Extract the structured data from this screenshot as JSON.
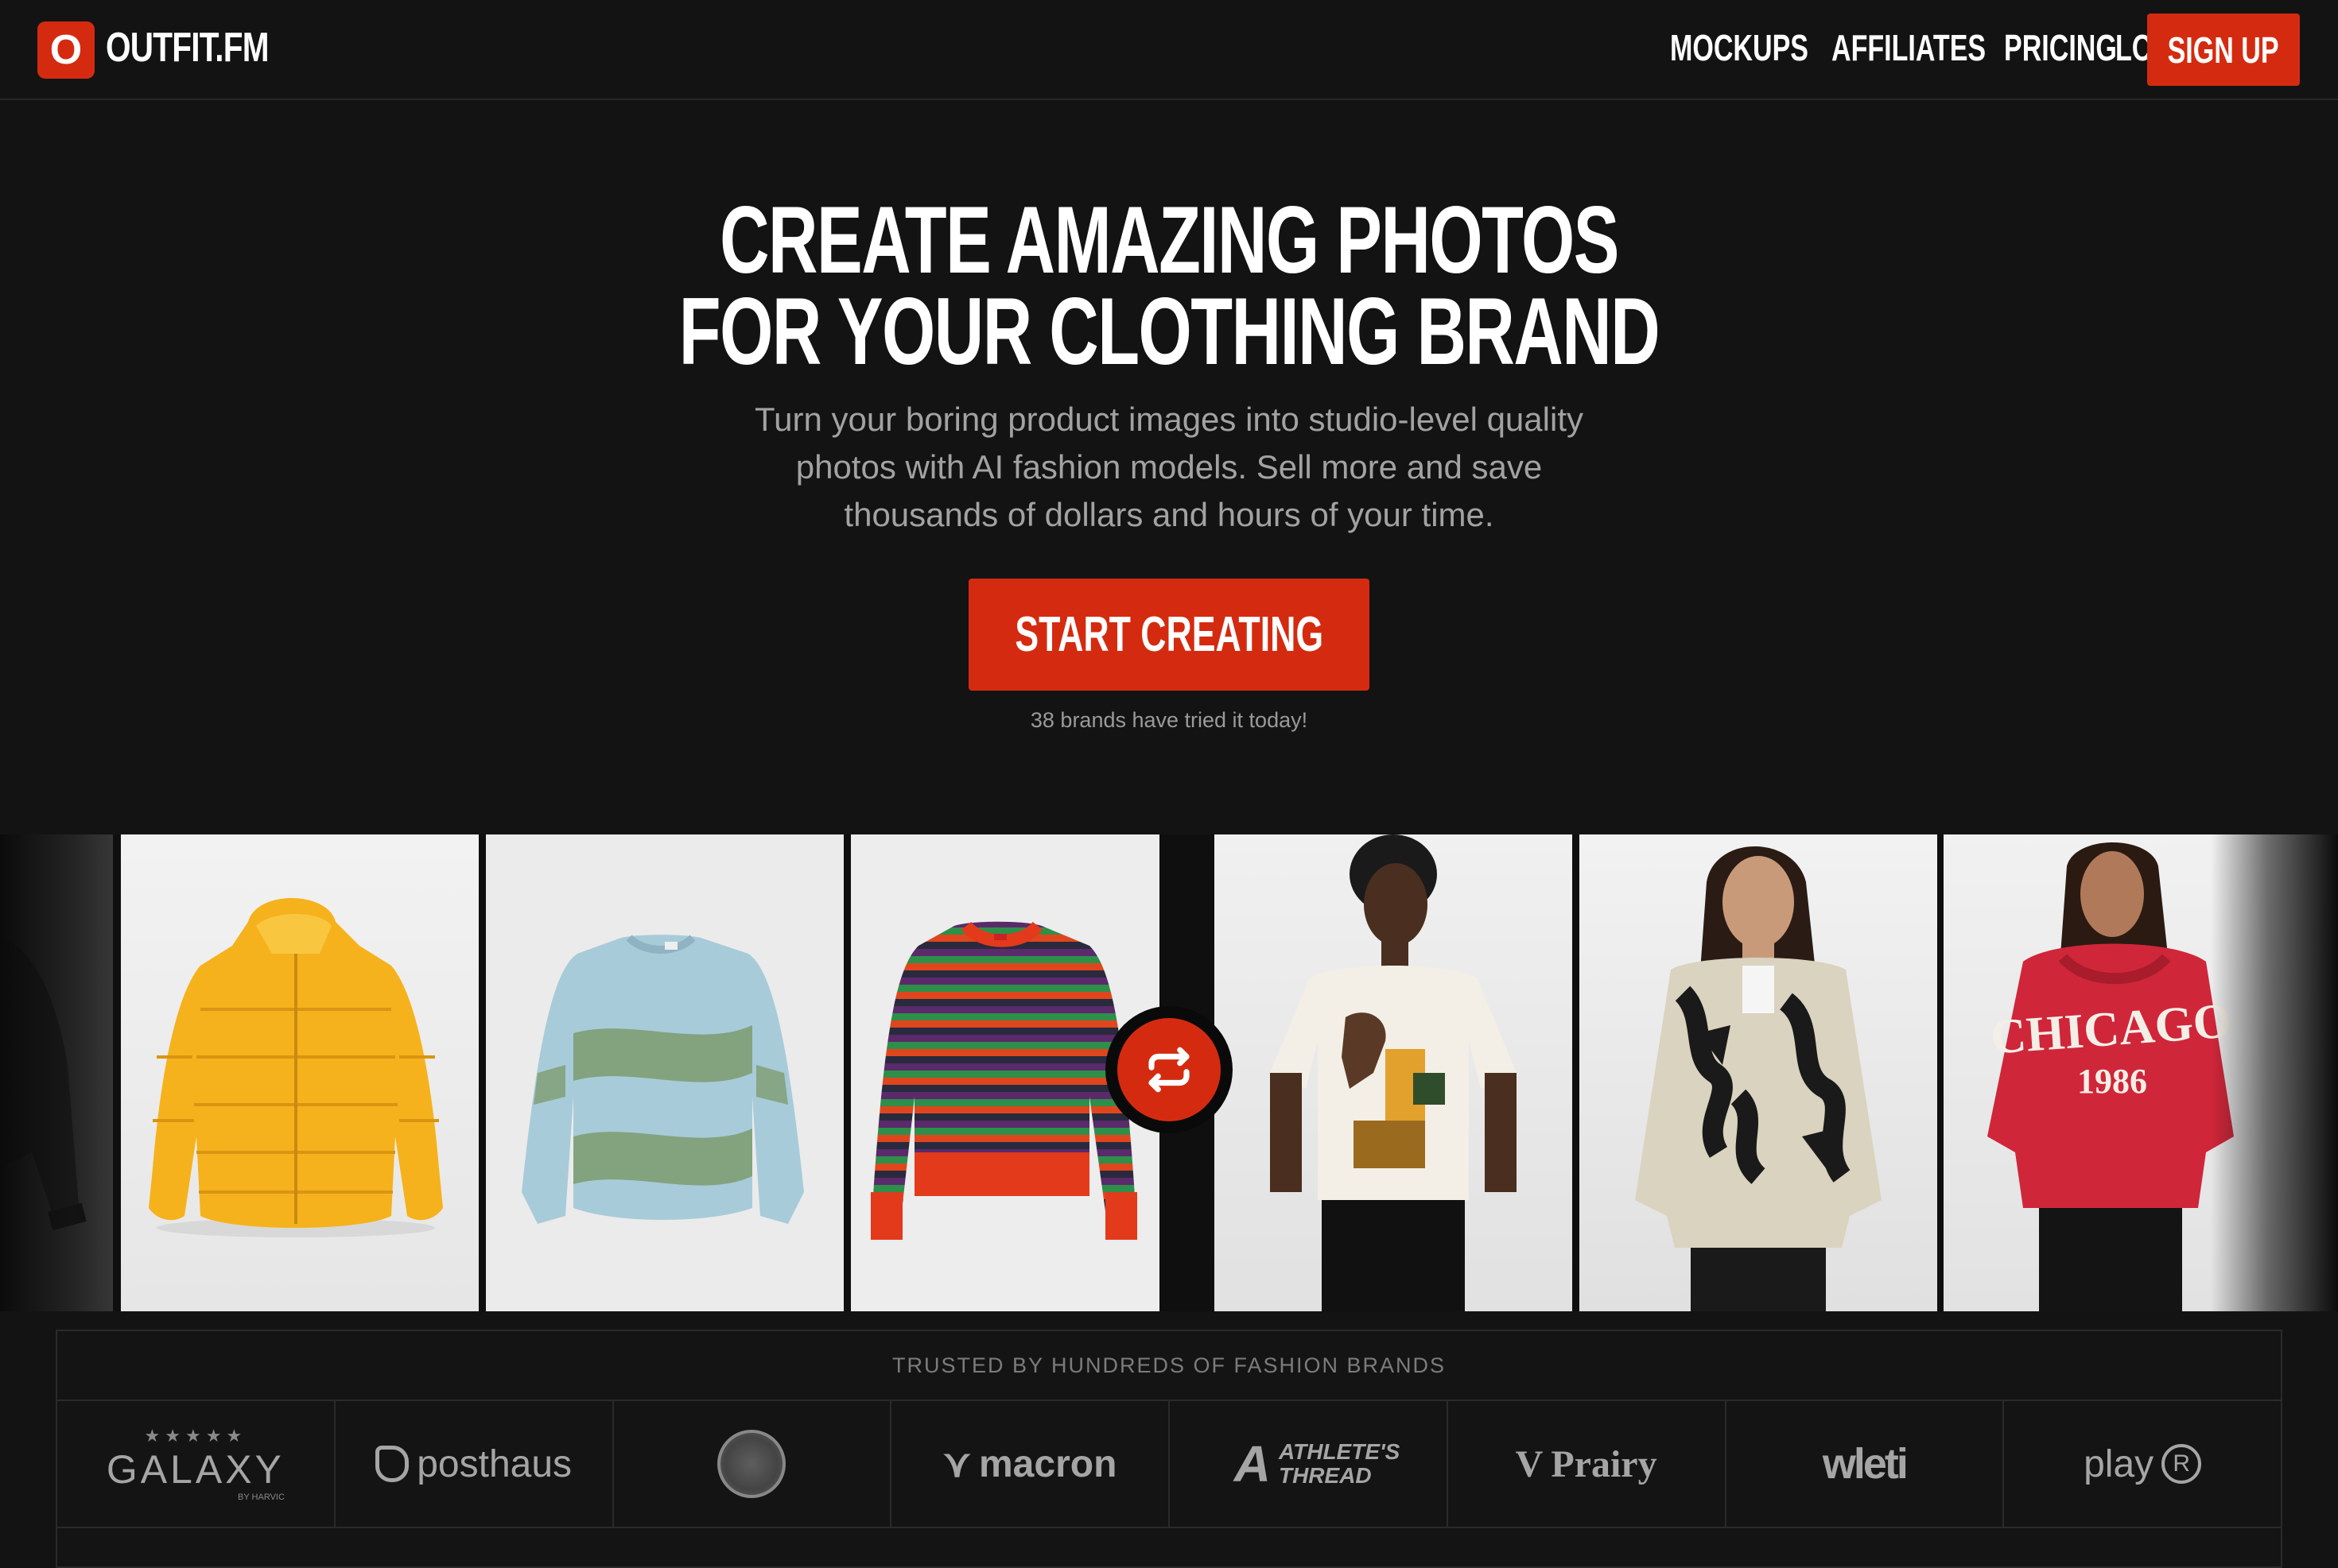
{
  "nav": {
    "logo_letter": "O",
    "logo_text": "OUTFIT.FM",
    "links": [
      "MOCKUPS",
      "AFFILIATES",
      "PRICING",
      "LOGIN"
    ],
    "signup": "SIGN UP"
  },
  "hero": {
    "title_line1": "CREATE AMAZING PHOTOS",
    "title_line2": "FOR YOUR CLOTHING BRAND",
    "subtitle": "Turn your boring product images into studio-level quality photos with AI fashion models. Sell more and save thousands of dollars and hours of your time.",
    "cta": "START CREATING",
    "tried": "38 brands have tried it today!"
  },
  "gallery": {
    "products": [
      "yellow puffer jacket",
      "blue-green striped sweater",
      "multicolor striped sweater"
    ],
    "models": [
      "model in abstract print tee",
      "model in patterned fleece jacket",
      "model in red hoodie"
    ],
    "hoodie_text_1": "CHICAGO",
    "hoodie_text_2": "1986"
  },
  "brands": {
    "heading": "TRUSTED BY HUNDREDS OF FASHION BRANDS",
    "logos": [
      "GALAXY",
      "posthaus",
      "seal",
      "macron",
      "ATHLETE'S THREAD",
      "Prairy",
      "wleti",
      "play"
    ],
    "galaxy_sub": "BY HARVIC"
  },
  "colors": {
    "accent": "#d42b10",
    "background": "#131313"
  }
}
